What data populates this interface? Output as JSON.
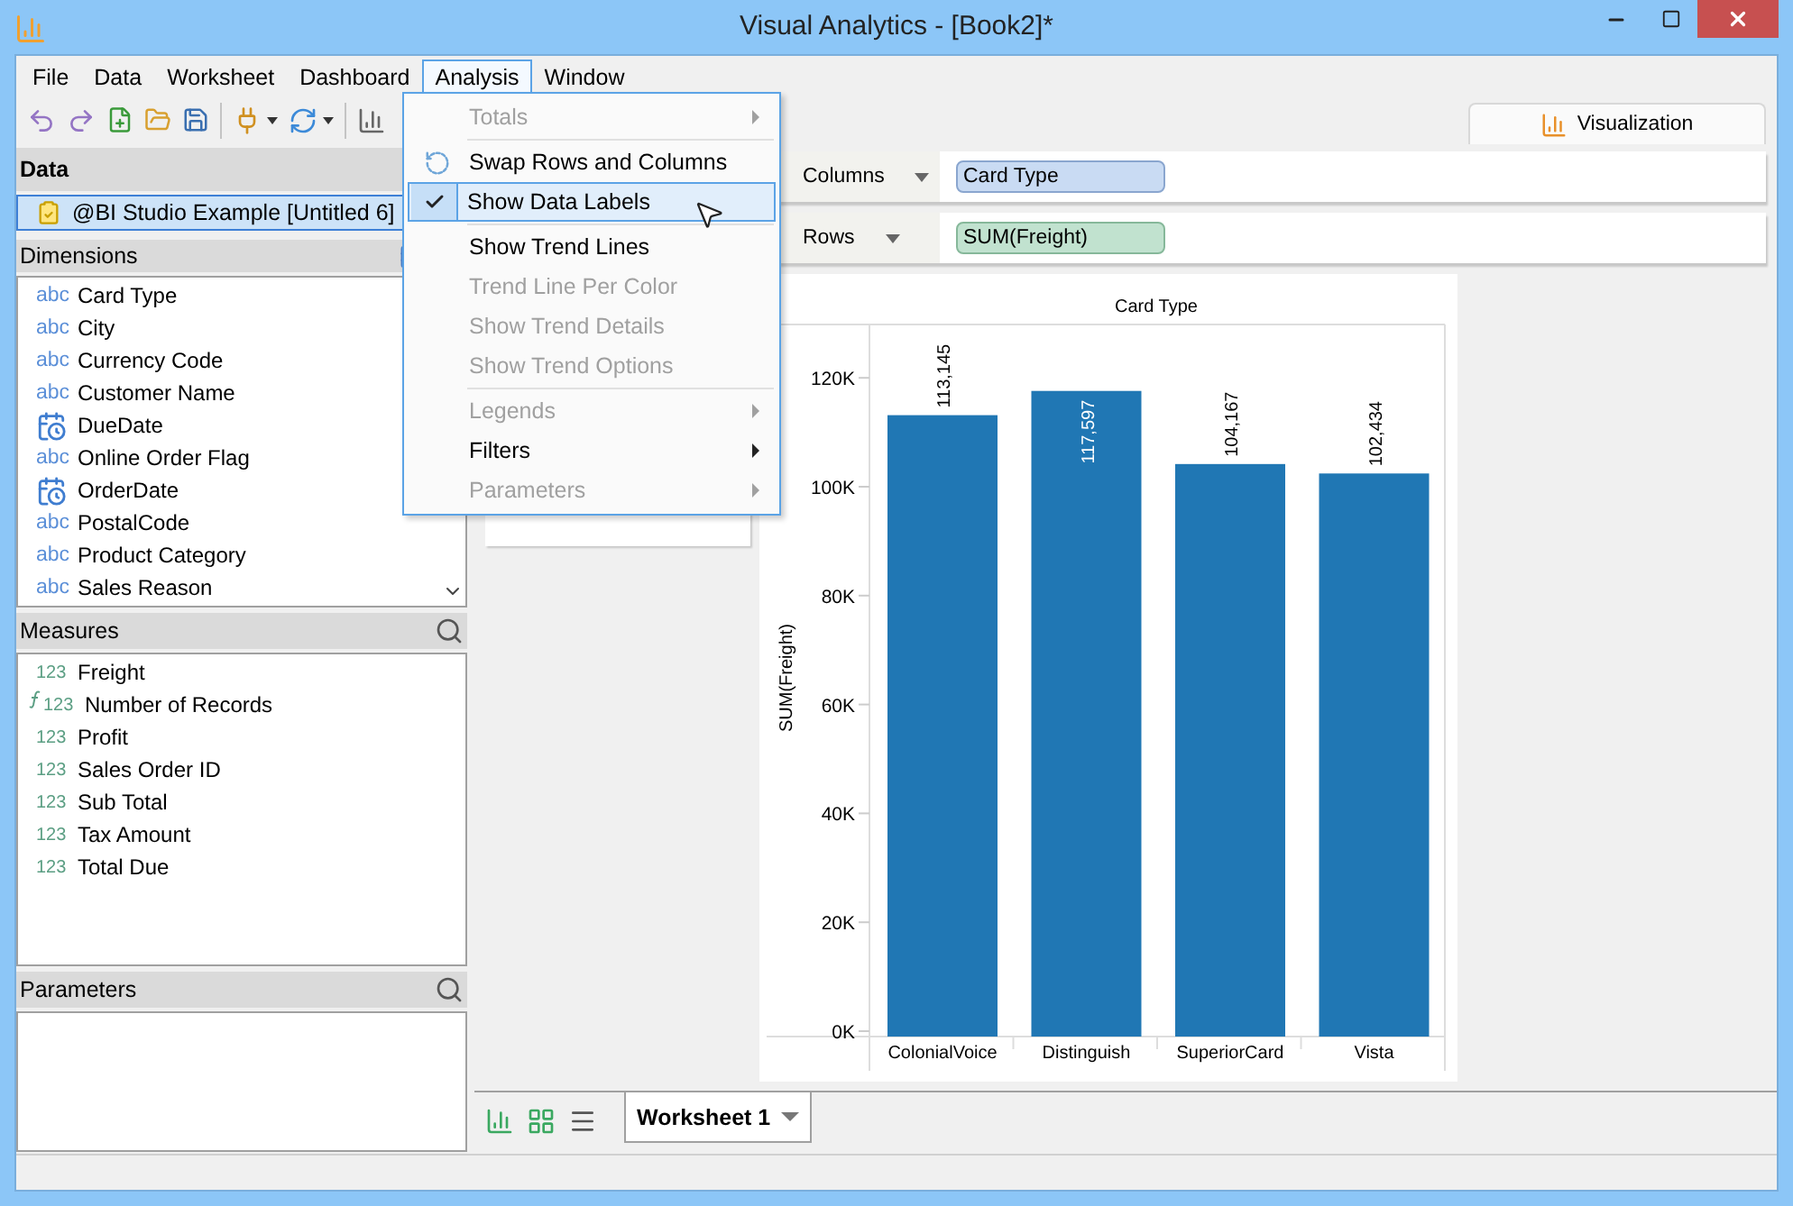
{
  "window": {
    "title": "Visual Analytics - [Book2]*"
  },
  "menu_bar": [
    {
      "label": "File",
      "selected": false
    },
    {
      "label": "Data",
      "selected": false
    },
    {
      "label": "Worksheet",
      "selected": false
    },
    {
      "label": "Dashboard",
      "selected": false
    },
    {
      "label": "Analysis",
      "selected": true
    },
    {
      "label": "Window",
      "selected": false
    }
  ],
  "analysis_menu": [
    {
      "kind": "item",
      "label": "Totals",
      "disabled": true,
      "checked": false,
      "selected": false,
      "submenu": true
    },
    {
      "kind": "separator"
    },
    {
      "kind": "icon-item",
      "label": "Swap Rows and Columns",
      "disabled": false,
      "checked": false,
      "selected": false,
      "submenu": false
    },
    {
      "kind": "item",
      "label": "Show Data Labels",
      "disabled": false,
      "checked": true,
      "selected": true,
      "submenu": false
    },
    {
      "kind": "separator"
    },
    {
      "kind": "item",
      "label": "Show Trend Lines",
      "disabled": false,
      "checked": false,
      "selected": false,
      "submenu": false
    },
    {
      "kind": "item",
      "label": "Trend Line Per Color",
      "disabled": true,
      "checked": false,
      "selected": false,
      "submenu": false
    },
    {
      "kind": "item",
      "label": "Show Trend Details",
      "disabled": true,
      "checked": false,
      "selected": false,
      "submenu": false
    },
    {
      "kind": "item",
      "label": "Show Trend Options",
      "disabled": true,
      "checked": false,
      "selected": false,
      "submenu": false
    },
    {
      "kind": "separator"
    },
    {
      "kind": "item",
      "label": "Legends",
      "disabled": true,
      "checked": false,
      "selected": false,
      "submenu": true
    },
    {
      "kind": "item",
      "label": "Filters",
      "disabled": false,
      "checked": false,
      "selected": false,
      "submenu": true
    },
    {
      "kind": "item",
      "label": "Parameters",
      "disabled": true,
      "checked": false,
      "selected": false,
      "submenu": true
    }
  ],
  "data_panel": {
    "title": "Data",
    "source": {
      "label": "@BI Studio Example [Untitled 6]",
      "selected": true
    }
  },
  "dimensions": {
    "title": "Dimensions",
    "items": [
      {
        "name": "Card Type",
        "kind": "text",
        "badge": "abc"
      },
      {
        "name": "City",
        "kind": "text",
        "badge": "abc"
      },
      {
        "name": "Currency Code",
        "kind": "text",
        "badge": "abc"
      },
      {
        "name": "Customer Name",
        "kind": "text",
        "badge": "abc"
      },
      {
        "name": "DueDate",
        "kind": "date"
      },
      {
        "name": "Online Order Flag",
        "kind": "text",
        "badge": "abc"
      },
      {
        "name": "OrderDate",
        "kind": "date"
      },
      {
        "name": "PostalCode",
        "kind": "text",
        "badge": "abc"
      },
      {
        "name": "Product Category",
        "kind": "text",
        "badge": "abc"
      },
      {
        "name": "Sales Reason",
        "kind": "text",
        "badge": "abc"
      }
    ]
  },
  "measures": {
    "title": "Measures",
    "items": [
      {
        "name": "Freight",
        "kind": "number",
        "badge": "123"
      },
      {
        "name": "Number of Records",
        "kind": "calculated",
        "badge": "123"
      },
      {
        "name": "Profit",
        "kind": "number",
        "badge": "123"
      },
      {
        "name": "Sales Order ID",
        "kind": "number",
        "badge": "123"
      },
      {
        "name": "Sub Total",
        "kind": "number",
        "badge": "123"
      },
      {
        "name": "Tax Amount",
        "kind": "number",
        "badge": "123"
      },
      {
        "name": "Total Due",
        "kind": "number",
        "badge": "123"
      }
    ]
  },
  "parameters": {
    "title": "Parameters"
  },
  "view_tabs": [
    {
      "label": "Visualization",
      "selected": true
    }
  ],
  "shelves": [
    {
      "label": "Columns",
      "kind": "dimension",
      "pill": "Card Type"
    },
    {
      "label": "Rows",
      "kind": "measure",
      "pill": "SUM(Freight)"
    }
  ],
  "chart": {
    "chart_data": {
      "type": "bar",
      "title": "Card Type",
      "ylabel": "SUM(Freight)",
      "categories": [
        "ColonialVoice",
        "Distinguish",
        "SuperiorCard",
        "Vista"
      ],
      "values": [
        113145,
        117597,
        104167,
        102434
      ],
      "ylim": [
        0,
        130000
      ],
      "yticks": [
        {
          "value": 0,
          "label": "0K"
        },
        {
          "value": 20000,
          "label": "20K"
        },
        {
          "value": 40000,
          "label": "40K"
        },
        {
          "value": 60000,
          "label": "60K"
        },
        {
          "value": 80000,
          "label": "80K"
        },
        {
          "value": 100000,
          "label": "100K"
        },
        {
          "value": 120000,
          "label": "120K"
        }
      ],
      "value_labels": [
        "113,145",
        "117,597",
        "104,167",
        "102,434"
      ]
    }
  },
  "sheet_tabs": [
    {
      "label": "Worksheet 1",
      "selected": true
    }
  ]
}
